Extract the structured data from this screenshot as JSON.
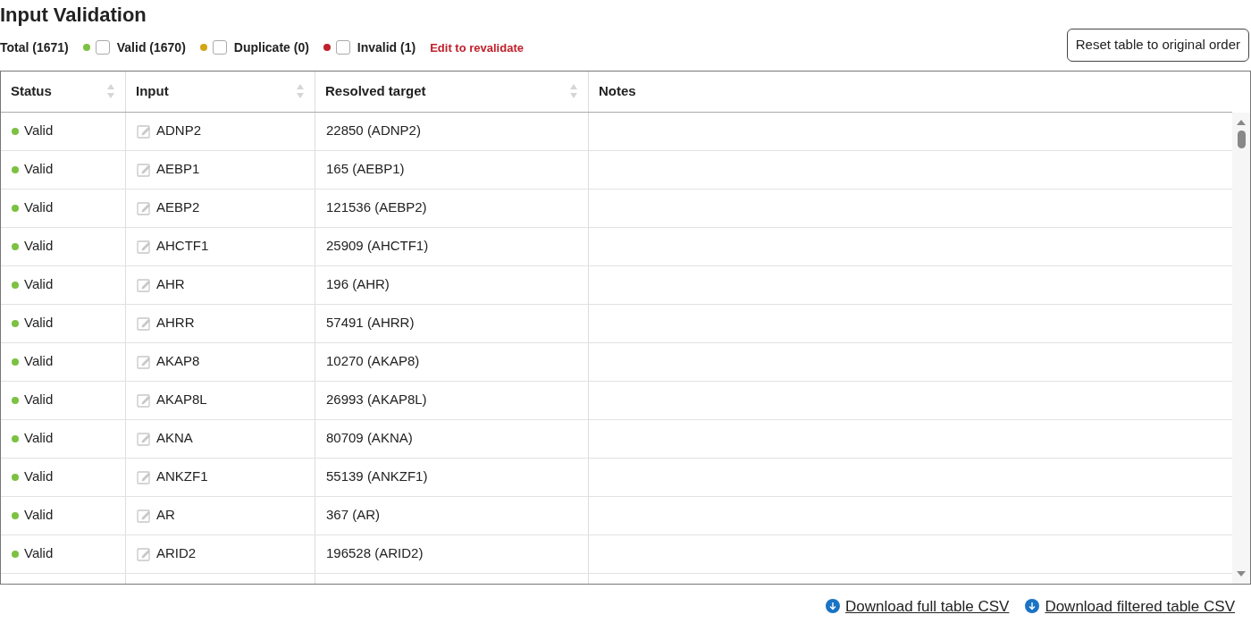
{
  "title": "Input Validation",
  "summary": {
    "total": "Total (1671)",
    "filters": [
      {
        "label": "Valid (1670)",
        "color": "#7cc142",
        "checked": false
      },
      {
        "label": "Duplicate (0)",
        "color": "#d4a514",
        "checked": false
      },
      {
        "label": "Invalid (1)",
        "color": "#c0202b",
        "checked": false
      }
    ],
    "hint": "Edit to revalidate"
  },
  "reset_button": "Reset table to original order",
  "table": {
    "columns": [
      {
        "label": "Status",
        "sortable": true
      },
      {
        "label": "Input",
        "sortable": true
      },
      {
        "label": "Resolved target",
        "sortable": true
      },
      {
        "label": "Notes",
        "sortable": false
      }
    ],
    "rows": [
      {
        "status": "Valid",
        "color": "#7cc142",
        "input": "ADNP2",
        "target": "22850 (ADNP2)"
      },
      {
        "status": "Valid",
        "color": "#7cc142",
        "input": "AEBP1",
        "target": "165 (AEBP1)"
      },
      {
        "status": "Valid",
        "color": "#7cc142",
        "input": "AEBP2",
        "target": "121536 (AEBP2)"
      },
      {
        "status": "Valid",
        "color": "#7cc142",
        "input": "AHCTF1",
        "target": "25909 (AHCTF1)"
      },
      {
        "status": "Valid",
        "color": "#7cc142",
        "input": "AHR",
        "target": "196 (AHR)"
      },
      {
        "status": "Valid",
        "color": "#7cc142",
        "input": "AHRR",
        "target": "57491 (AHRR)"
      },
      {
        "status": "Valid",
        "color": "#7cc142",
        "input": "AKAP8",
        "target": "10270 (AKAP8)"
      },
      {
        "status": "Valid",
        "color": "#7cc142",
        "input": "AKAP8L",
        "target": "26993 (AKAP8L)"
      },
      {
        "status": "Valid",
        "color": "#7cc142",
        "input": "AKNA",
        "target": "80709 (AKNA)"
      },
      {
        "status": "Valid",
        "color": "#7cc142",
        "input": "ANKZF1",
        "target": "55139 (ANKZF1)"
      },
      {
        "status": "Valid",
        "color": "#7cc142",
        "input": "AR",
        "target": "367 (AR)"
      },
      {
        "status": "Valid",
        "color": "#7cc142",
        "input": "ARID2",
        "target": "196528 (ARID2)"
      }
    ]
  },
  "downloads": [
    "Download full table CSV",
    "Download filtered table CSV"
  ]
}
